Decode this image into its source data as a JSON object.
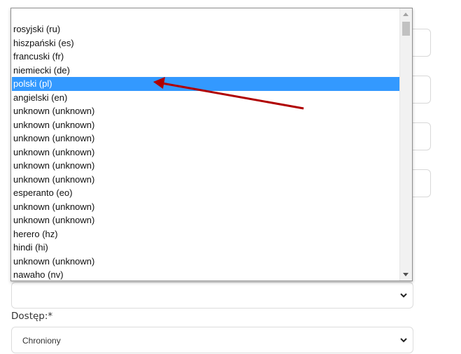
{
  "listbox": {
    "options": [
      "rosyjski (ru)",
      "hiszpański (es)",
      "francuski (fr)",
      "niemiecki (de)",
      "polski (pl)",
      "angielski (en)",
      "unknown (unknown)",
      "unknown (unknown)",
      "unknown (unknown)",
      "unknown (unknown)",
      "unknown (unknown)",
      "unknown (unknown)",
      "esperanto (eo)",
      "unknown (unknown)",
      "unknown (unknown)",
      "herero (hz)",
      "hindi (hi)",
      "unknown (unknown)",
      "nawaho (nv)"
    ],
    "selected_index": 4
  },
  "form": {
    "access_label": "Dostęp:*",
    "access_value": "Chroniony",
    "language_value": ""
  },
  "colors": {
    "selection": "#3399ff",
    "annotation_arrow": "#b00000"
  }
}
